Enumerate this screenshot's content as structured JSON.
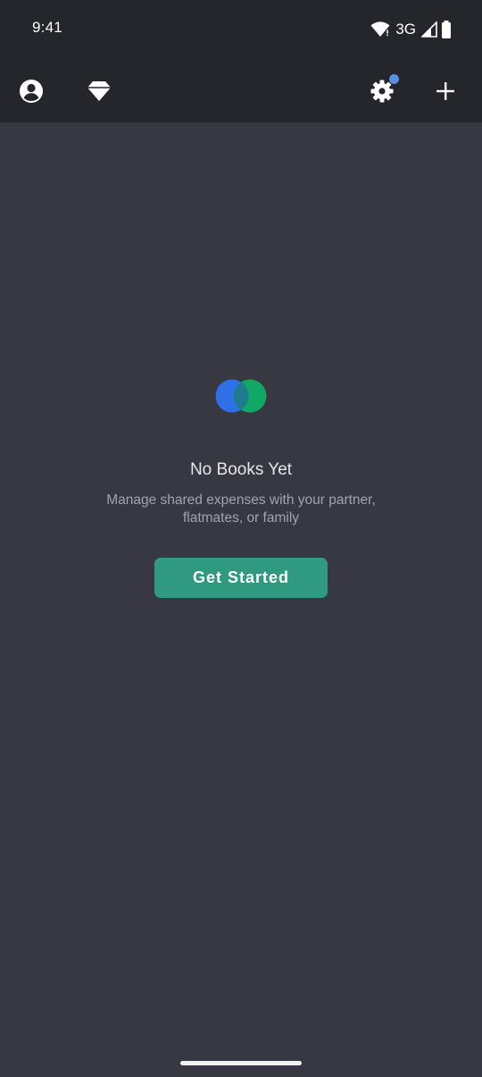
{
  "status_bar": {
    "time": "9:41",
    "network": "3G",
    "icons": [
      "wifi-icon",
      "signal-icon",
      "battery-icon"
    ]
  },
  "app_bar": {
    "left_icons": [
      "account-icon",
      "diamond-icon"
    ],
    "right_icons": [
      "gear-icon",
      "plus-icon"
    ],
    "notification_color": "#5b8de3"
  },
  "empty_state": {
    "title": "No Books Yet",
    "subtitle": "Manage shared expenses with your partner, flatmates, or family",
    "button_label": "Get Started",
    "logo_colors": {
      "left": "#2f6fe8",
      "right": "#11a765",
      "overlap": "#1e7a8c"
    }
  },
  "colors": {
    "background": "#383842",
    "bar": "#25252c",
    "accent": "#2f9a7f"
  }
}
